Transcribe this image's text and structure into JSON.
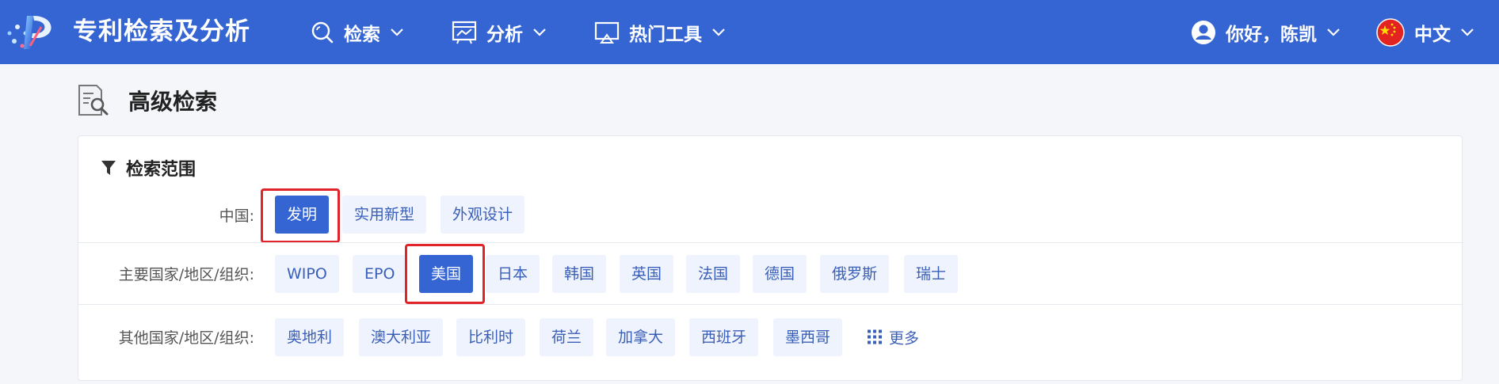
{
  "header": {
    "app_title": "专利检索及分析",
    "nav": {
      "search": "检索",
      "analysis": "分析",
      "tools": "热门工具"
    },
    "user_greeting": "你好，陈凯",
    "language": "中文"
  },
  "page": {
    "title": "高级检索"
  },
  "panel": {
    "title": "检索范围",
    "china": {
      "label": "中国:",
      "chips": [
        "发明",
        "实用新型",
        "外观设计"
      ]
    },
    "major": {
      "label": "主要国家/地区/组织:",
      "chips": [
        "WIPO",
        "EPO",
        "美国",
        "日本",
        "韩国",
        "英国",
        "法国",
        "德国",
        "俄罗斯",
        "瑞士"
      ]
    },
    "other": {
      "label": "其他国家/地区/组织:",
      "chips": [
        "奥地利",
        "澳大利亚",
        "比利时",
        "荷兰",
        "加拿大",
        "西班牙",
        "墨西哥"
      ],
      "more_label": "更多"
    }
  },
  "colors": {
    "header_bg": "#3564d3",
    "chip_bg": "#eef3fd",
    "chip_text": "#3a5fb8",
    "chip_active_bg": "#3564d3",
    "highlight": "#e0242a"
  }
}
